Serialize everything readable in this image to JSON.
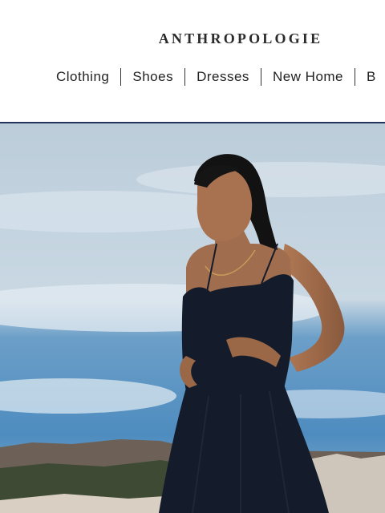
{
  "brand": {
    "logo_text": "ANTHROPOLOGIE"
  },
  "nav": {
    "items": [
      "Clothing",
      "Shoes",
      "Dresses",
      "New Home",
      "B"
    ]
  },
  "hero": {
    "image_alt": "",
    "colors": {
      "sky_top": "#b9cbd9",
      "sky_bottom": "#4f8fc0",
      "dress": "#141b2a",
      "skin": "#9a6a4c",
      "hills": "#6b5e52"
    }
  }
}
